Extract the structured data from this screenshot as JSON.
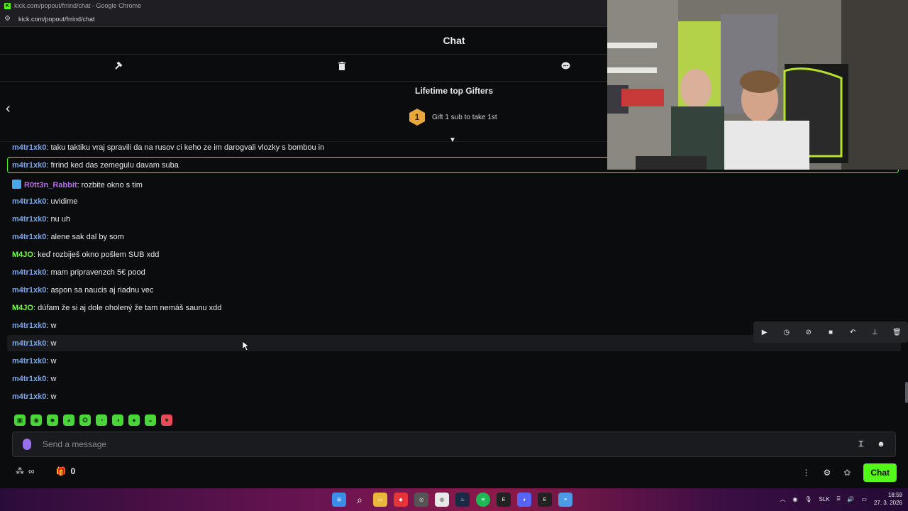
{
  "browser": {
    "window_title": "kick.com/popout/frrind/chat - Google Chrome",
    "url": "kick.com/popout/frrind/chat"
  },
  "chat": {
    "title": "Chat"
  },
  "gifters": {
    "title": "Lifetime top Gifters",
    "rank": "1",
    "prompt": "Gift 1 sub to take 1st"
  },
  "messages": [
    {
      "user": "m4tr1xk0",
      "text": ": taku taktiku vraj spravili da na rusov ci keho ze im darogvali vlozky s bombou in",
      "color": "#7aa6e8"
    },
    {
      "user": "m4tr1xk0",
      "text": ": frrind ked das zemegulu davam suba",
      "color": "#7aa6e8"
    },
    {
      "user": "R0tt3n_Rabbit",
      "text": ": rozbite okno s tim",
      "color": "#b56ee8"
    },
    {
      "user": "m4tr1xk0",
      "text": ": uvidime",
      "color": "#7aa6e8"
    },
    {
      "user": "m4tr1xk0",
      "text": ": nu uh",
      "color": "#7aa6e8"
    },
    {
      "user": "m4tr1xk0",
      "text": ": alene sak dal by som",
      "color": "#7aa6e8"
    },
    {
      "user": "M4JO",
      "text": ": keď rozbiješ okno pošlem SUB xdd",
      "color": "#7cf84e"
    },
    {
      "user": "m4tr1xk0",
      "text": ": mam pripravenzch 5€ pood",
      "color": "#7aa6e8"
    },
    {
      "user": "m4tr1xk0",
      "text": ": aspon sa naucis aj riadnu vec",
      "color": "#7aa6e8"
    },
    {
      "user": "M4JO",
      "text": ": dúfam že si aj dole oholený že tam nemáš saunu xdd",
      "color": "#7cf84e"
    },
    {
      "user": "m4tr1xk0",
      "text": ": w",
      "color": "#7aa6e8"
    },
    {
      "user": "m4tr1xk0",
      "text": ": w",
      "color": "#7aa6e8"
    },
    {
      "user": "m4tr1xk0",
      "text": ": w",
      "color": "#7aa6e8"
    },
    {
      "user": "m4tr1xk0",
      "text": ": w",
      "color": "#7aa6e8"
    },
    {
      "user": "m4tr1xk0",
      "text": ": w",
      "color": "#7aa6e8"
    }
  ],
  "input": {
    "placeholder": "Send a message"
  },
  "footer": {
    "points": "∞",
    "gifts_count": "0",
    "chat_button": "Chat"
  },
  "taskbar": {
    "language": "SLK",
    "time": "18:59",
    "date": "27. 3. 2026"
  },
  "colors": {
    "accent": "#53fc18",
    "background": "#0b0c0e"
  }
}
